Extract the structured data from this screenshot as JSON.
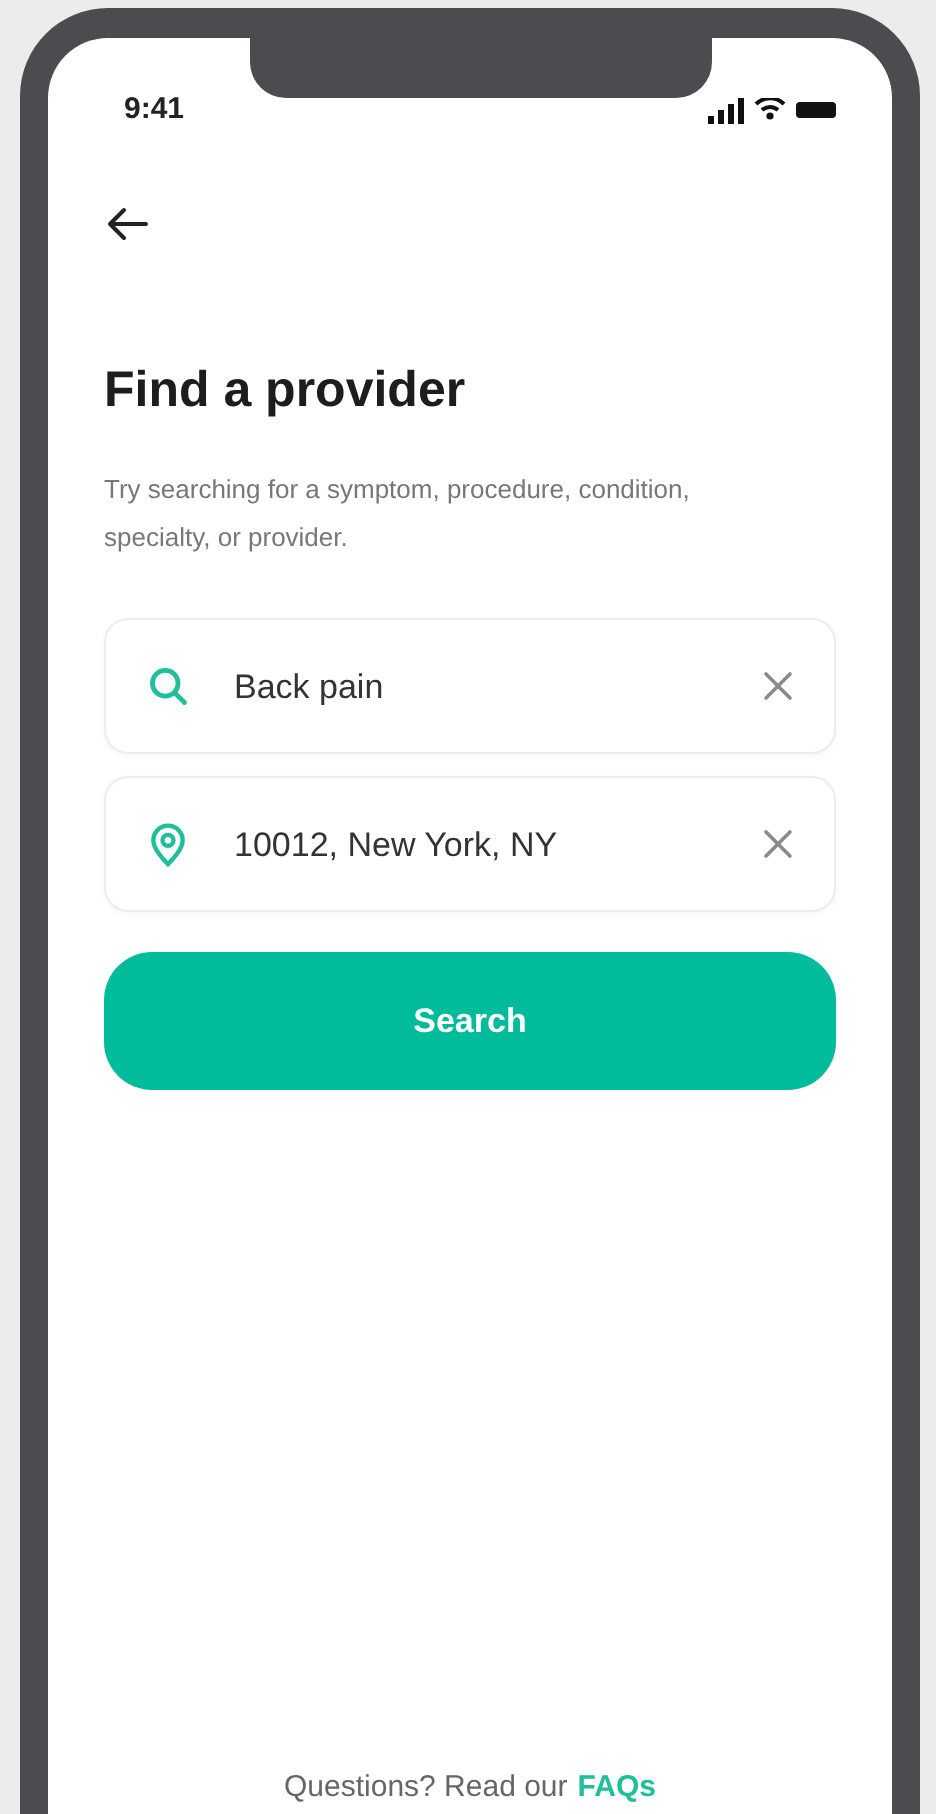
{
  "status_bar": {
    "time": "9:41"
  },
  "title": "Find a provider",
  "subtitle": "Try searching for a symptom, procedure, condition, specialty, or provider.",
  "fields": [
    {
      "kind": "search",
      "value": "Back pain"
    },
    {
      "kind": "location",
      "value": "10012, New York, NY"
    }
  ],
  "search_button": "Search",
  "footer": {
    "text": "Questions? Read our",
    "link": "FAQs"
  }
}
